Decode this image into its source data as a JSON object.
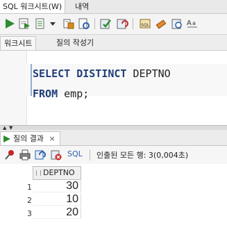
{
  "tabs": [
    {
      "label": "SQL 워크시트(W)"
    },
    {
      "label": "내역"
    }
  ],
  "toolbar": {
    "icons": [
      "run-statement-icon",
      "run-script-icon",
      "autotrace-icon",
      "dropdown-arrow-icon",
      "explain-plan-icon",
      "sql-tuning-icon",
      "commit-icon",
      "rollback-icon",
      "sql-history-icon",
      "eraser-icon",
      "clear-icon",
      "format-text-icon"
    ]
  },
  "subtabs": [
    {
      "label": "워크시트"
    },
    {
      "label": "질의 작성기"
    }
  ],
  "editor": {
    "line1_kw": "SELECT DISTINCT",
    "line1_rest": " DEPTNO",
    "line2_kw": "FROM",
    "line2_rest": " emp;"
  },
  "results": {
    "tab_label": "질의 결과",
    "close_label": "×",
    "sql_label": "SQL",
    "status": "인출된 모든 행: 3(0,004초)",
    "column_header": "DEPTNO",
    "rows": [
      {
        "num": "1",
        "deptno": "30"
      },
      {
        "num": "2",
        "deptno": "10"
      },
      {
        "num": "3",
        "deptno": "20"
      }
    ]
  },
  "colors": {
    "keyword": "#1f3e7a",
    "run_green": "#2e8b2e",
    "pin_red": "#cc2222"
  }
}
